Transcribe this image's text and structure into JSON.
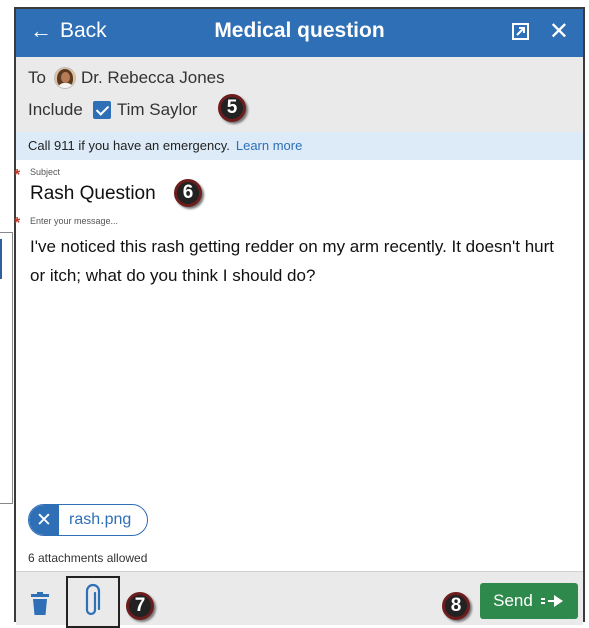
{
  "header": {
    "back_label": "Back",
    "title": "Medical question",
    "popout_icon": "popout-icon",
    "close_icon": "close-icon"
  },
  "recipient": {
    "to_label": "To",
    "name": "Dr. Rebecca Jones"
  },
  "include": {
    "label": "Include",
    "person": "Tim Saylor",
    "checked": true
  },
  "alert": {
    "text": "Call 911 if you have an emergency.",
    "link": "Learn more"
  },
  "subject": {
    "label": "Subject",
    "value": "Rash Question"
  },
  "message": {
    "placeholder": "Enter your message...",
    "value": "I've noticed this rash getting redder on my arm recently. It doesn't hurt or itch; what do you think I should do?"
  },
  "attachments": {
    "files": [
      "rash.png"
    ],
    "note": "6 attachments allowed"
  },
  "footer": {
    "send_label": "Send"
  },
  "callouts": [
    "5",
    "6",
    "7",
    "8"
  ],
  "colors": {
    "header_bg": "#2f6fb6",
    "send_bg": "#2d8a4c",
    "alert_bg": "#dcebf7",
    "required": "#c0392b"
  }
}
